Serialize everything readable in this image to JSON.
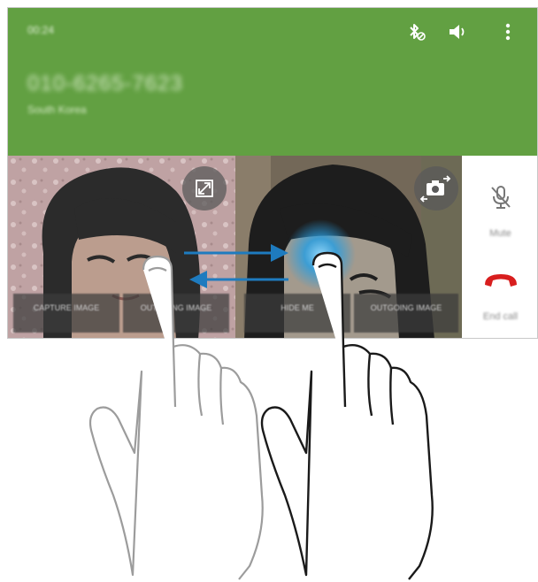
{
  "status": {
    "time": "00:24",
    "icons": [
      "bluetooth-off-icon",
      "speaker-icon",
      "more-options-icon"
    ]
  },
  "call": {
    "number": "010-6265-7623",
    "country": "South Korea"
  },
  "video_left": {
    "expand_icon": "expand-icon",
    "capture_button": "CAPTURE IMAGE",
    "outgoing_button": "OUTGOING IMAGE"
  },
  "video_right": {
    "switch_camera_icon": "switch-camera-icon",
    "hide_button": "HIDE ME",
    "outgoing_button": "OUTGOING IMAGE"
  },
  "side_panel": {
    "mute_label": "Mute",
    "end_call_label": "End call",
    "end_call_color": "#d81e1e"
  },
  "colors": {
    "header_green": "#62a042",
    "swipe_arrow_blue": "#1e7bbf"
  }
}
